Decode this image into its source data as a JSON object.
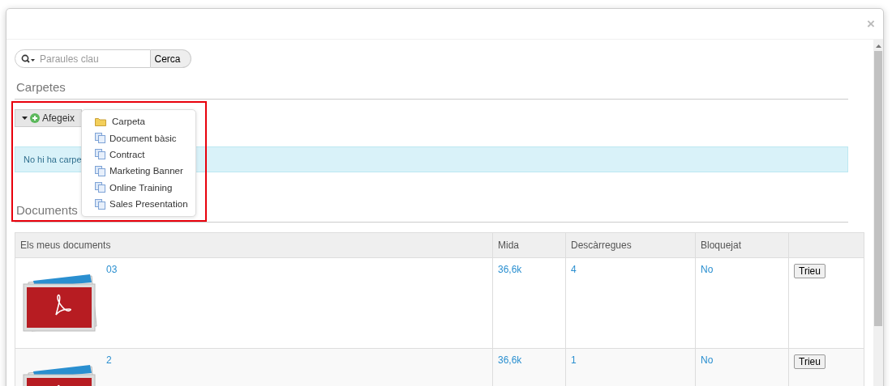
{
  "modal": {
    "close": "×"
  },
  "search": {
    "placeholder": "Paraules clau",
    "button": "Cerca"
  },
  "folders": {
    "title": "Carpetes",
    "add_button": "Afegeix",
    "alert": "No hi ha carpe"
  },
  "add_menu": [
    {
      "kind": "folder",
      "label": "Carpeta"
    },
    {
      "kind": "document",
      "label": "Document bàsic"
    },
    {
      "kind": "document",
      "label": "Contract"
    },
    {
      "kind": "document",
      "label": "Marketing Banner"
    },
    {
      "kind": "document",
      "label": "Online Training"
    },
    {
      "kind": "document",
      "label": "Sales Presentation"
    }
  ],
  "documents": {
    "title": "Documents",
    "table": {
      "columns": [
        "Els meus documents",
        "Mida",
        "Descàrregues",
        "Bloquejat"
      ],
      "rows": [
        {
          "name": "03",
          "size": "36,6k",
          "downloads": "4",
          "locked": "No",
          "action": "Trieu"
        },
        {
          "name": "2",
          "size": "36,6k",
          "downloads": "1",
          "locked": "No",
          "action": "Trieu"
        }
      ]
    }
  }
}
